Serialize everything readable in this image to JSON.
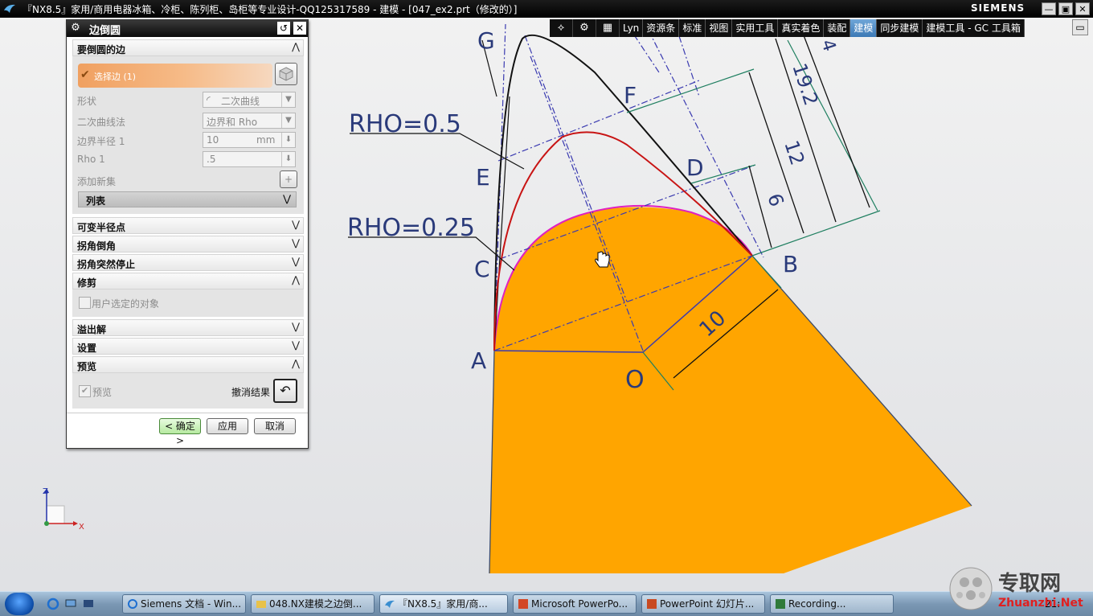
{
  "window": {
    "title": "『NX8.5』家用/商用电器冰箱、冷柜、陈列柜、岛柜等专业设计-QQ125317589 - 建模 - [047_ex2.prt（修改的）]",
    "brand": "SIEMENS",
    "buttons": [
      "—",
      "▣",
      "✕"
    ]
  },
  "toolbar": {
    "tabs": [
      "Lyn",
      "资源条",
      "标准",
      "视图",
      "实用工具",
      "真实着色",
      "装配",
      "建模",
      "同步建模",
      "建模工具 - GC 工具箱"
    ],
    "active_tab": "建模"
  },
  "dialog": {
    "title": "边倒圆",
    "sections": {
      "edges": "要倒圆的边",
      "variable": "可变半径点",
      "corner_setback": "拐角倒角",
      "corner_stop": "拐角突然停止",
      "trim": "修剪",
      "overflow": "溢出解",
      "settings": "设置",
      "preview": "预览"
    },
    "select_edge": "选择边 (1)",
    "shape_label": "形状",
    "shape_value": "二次曲线",
    "conic_method_label": "二次曲线法",
    "conic_method_value": "边界和 Rho",
    "boundary_radius_label": "边界半径 1",
    "boundary_radius_value": "10",
    "boundary_radius_unit": "mm",
    "rho_label": "Rho 1",
    "rho_value": ".5",
    "add_new_set": "添加新集",
    "list": "列表",
    "user_selected_objects": "用户选定的对象",
    "preview_checkbox": "预览",
    "undo_result": "撤消结果",
    "ok_button": "< 确定 >",
    "apply_button": "应用",
    "cancel_button": "取消"
  },
  "drawing": {
    "labels": {
      "G": "G",
      "F": "F",
      "E": "E",
      "D": "D",
      "C": "C",
      "B": "B",
      "A": "A",
      "O": "O",
      "rho_05": "RHO=0.5",
      "rho_025": "RHO=0.25"
    },
    "dimensions": {
      "d10": "10",
      "d6": "6",
      "d12": "12",
      "d192": "19.2",
      "d4": "4"
    },
    "colors": {
      "solid": "#FFA500",
      "red_curve": "#C81414",
      "magenta_curve": "#E020C0",
      "construction": "#3A3AB0",
      "dim_line": "#1F7F60"
    }
  },
  "triad": {
    "z": "Z",
    "x": "X"
  },
  "taskbar": {
    "items": [
      "Siemens 文档 - Win...",
      "048.NX建模之边倒...",
      "『NX8.5』家用/商...",
      "Microsoft PowerPo...",
      "PowerPoint 幻灯片...",
      "Recording..."
    ],
    "clock": "21:",
    "watermark_cn": "专取网",
    "watermark_en": "Zhuanzhi.Net"
  }
}
